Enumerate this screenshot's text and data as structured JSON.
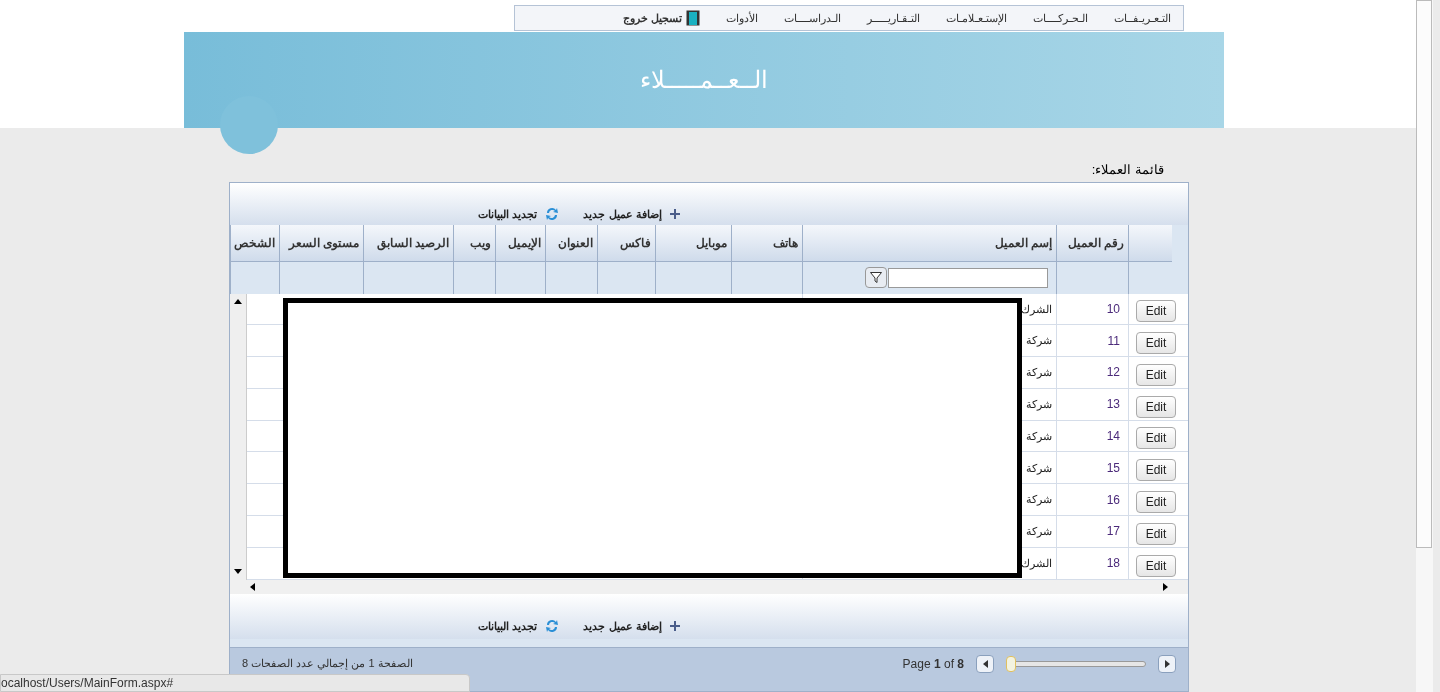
{
  "menu": {
    "items": [
      "التـعـريـفــات",
      "الـحـركــــات",
      "الإستـعـلامـات",
      "التـقـاريـــــر",
      "الـدراســــات",
      "الأدوات"
    ],
    "logout": "تسجيل خروج"
  },
  "header": {
    "title": "الــعــمـــــلاء"
  },
  "list_label": "قائمة العملاء:",
  "toolbar_top": {
    "add": "إضافة عميل جديد",
    "refresh": "تجديد البيانات"
  },
  "table": {
    "columns": [
      "رقم العميل",
      "إسم العميل",
      "هاتف",
      "موبايل",
      "فاكس",
      "العنوان",
      "الإيميل",
      "ويب",
      "الرصيد السابق",
      "مستوى السعر",
      "الشخص"
    ],
    "rows": [
      {
        "edit": "Edit",
        "number": "10",
        "name": "الشرك"
      },
      {
        "edit": "Edit",
        "number": "11",
        "name": "شركة"
      },
      {
        "edit": "Edit",
        "number": "12",
        "name": "شركة"
      },
      {
        "edit": "Edit",
        "number": "13",
        "name": "شركة"
      },
      {
        "edit": "Edit",
        "number": "14",
        "name": "شركة"
      },
      {
        "edit": "Edit",
        "number": "15",
        "name": "شركة"
      },
      {
        "edit": "Edit",
        "number": "16",
        "name": "شركة"
      },
      {
        "edit": "Edit",
        "number": "17",
        "name": "شركة"
      },
      {
        "edit": "Edit",
        "number": "18",
        "name": "الشرك"
      }
    ]
  },
  "toolbar_bottom": {
    "add": "إضافة عميل جديد",
    "refresh": "تجديد البيانات"
  },
  "pager": {
    "summary": "الصفحة 1 من إجمالي عدد الصفحات 8",
    "page_label": "Page **1** of **8**",
    "level": 0
  },
  "status_bar": "ocalhost/Users/MainForm.aspx#"
}
